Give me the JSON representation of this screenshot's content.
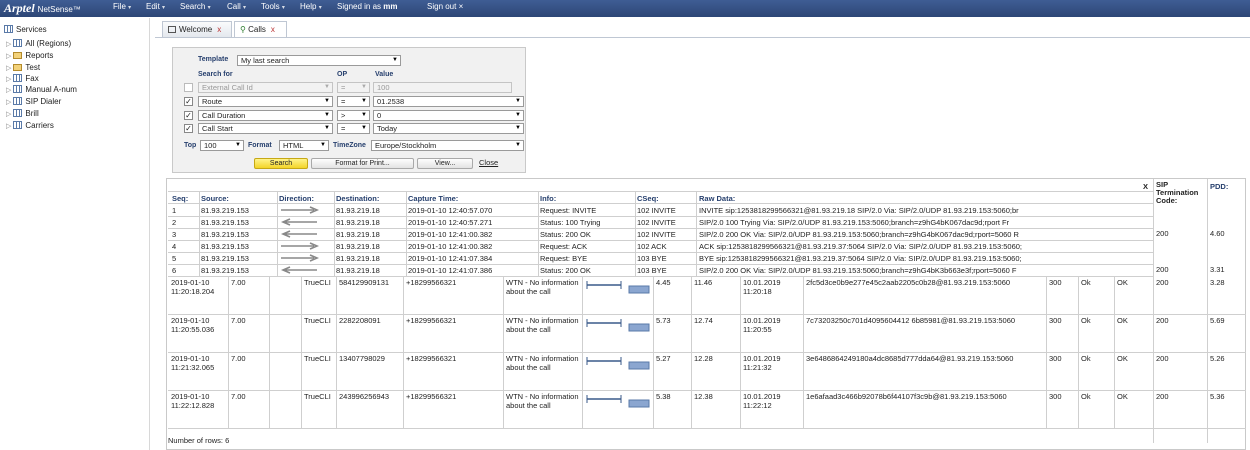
{
  "app": {
    "brand": "Arptel",
    "product": "NetSense™"
  },
  "menu": [
    {
      "label": "File",
      "arrow": "▾"
    },
    {
      "label": "Edit",
      "arrow": "▾"
    },
    {
      "label": "Search",
      "arrow": "▾"
    },
    {
      "label": "Call",
      "arrow": "▾"
    },
    {
      "label": "Tools",
      "arrow": "▾"
    },
    {
      "label": "Help",
      "arrow": "▾"
    },
    {
      "label": "Signed in as"
    },
    {
      "label": "Sign out"
    }
  ],
  "user": "mm",
  "tree": {
    "root": "Services",
    "items": [
      {
        "label": "All (Regions)",
        "icon": "grid-icon"
      },
      {
        "label": "Reports",
        "icon": "folder-icon"
      },
      {
        "label": "Test",
        "icon": "folder-icon"
      },
      {
        "label": "Fax",
        "icon": "grid-icon"
      },
      {
        "label": "Manual A-num",
        "icon": "grid-icon"
      },
      {
        "label": "SIP Dialer",
        "icon": "grid-icon"
      },
      {
        "label": "Brill",
        "icon": "grid-icon"
      },
      {
        "label": "Carriers",
        "icon": "grid-icon"
      }
    ]
  },
  "tabs": [
    {
      "label": "Welcome",
      "close": "x"
    },
    {
      "label": "Calls",
      "close": "x"
    }
  ],
  "search": {
    "template_label": "Template",
    "template_value": "My last search",
    "search_for_label": "Search for",
    "op_label": "OP",
    "value_label": "Value",
    "rows": [
      {
        "checked": false,
        "field": "External Call Id",
        "op": "=",
        "value": "100"
      },
      {
        "checked": true,
        "field": "Route",
        "op": "=",
        "value": "01.2538"
      },
      {
        "checked": true,
        "field": "Call Duration",
        "op": ">",
        "value": "0"
      },
      {
        "checked": true,
        "field": "Call Start",
        "op": "=",
        "value": "Today"
      }
    ],
    "top_label": "Top",
    "top_value": "100",
    "format_label": "Format",
    "format_value": "HTML",
    "timezone_label": "TimeZone",
    "timezone_value": "Europe/Stockholm",
    "buttons": {
      "search": "Search",
      "print": "Format for Print...",
      "view": "View...",
      "close": "Close"
    }
  },
  "trace": {
    "close": "X",
    "headers": [
      "Seq:",
      "Source:",
      "Direction:",
      "Destination:",
      "Capture Time:",
      "Info:",
      "CSeq:",
      "Raw Data:"
    ],
    "rows": [
      {
        "seq": "1",
        "src": "81.93.219.153",
        "dir": "right",
        "dst": "81.93.219.18",
        "time": "2019-01-10 12:40:57.070",
        "info": "Request: INVITE",
        "cseq": "102 INVITE",
        "raw": "INVITE sip:1253818299566321@81.93.219.18 SIP/2.0 Via: SIP/2.0/UDP 81.93.219.153:5060;br"
      },
      {
        "seq": "2",
        "src": "81.93.219.153",
        "dir": "left",
        "dst": "81.93.219.18",
        "time": "2019-01-10 12:40:57.271",
        "info": "Status: 100 Trying",
        "cseq": "102 INVITE",
        "raw": "SIP/2.0 100 Trying Via: SIP/2.0/UDP 81.93.219.153:5060;branch=z9hG4bK067dac9d;rport Fr"
      },
      {
        "seq": "3",
        "src": "81.93.219.153",
        "dir": "left",
        "dst": "81.93.219.18",
        "time": "2019-01-10 12:41:00.382",
        "info": "Status: 200 OK",
        "cseq": "102 INVITE",
        "raw": "SIP/2.0 200 OK Via: SIP/2.0/UDP 81.93.219.153:5060;branch=z9hG4bK067dac9d;rport=5060 R"
      },
      {
        "seq": "4",
        "src": "81.93.219.153",
        "dir": "right",
        "dst": "81.93.219.18",
        "time": "2019-01-10 12:41:00.382",
        "info": "Request: ACK",
        "cseq": "102 ACK",
        "raw": "ACK sip:1253818299566321@81.93.219.37:5064 SIP/2.0 Via: SIP/2.0/UDP 81.93.219.153:5060;"
      },
      {
        "seq": "5",
        "src": "81.93.219.153",
        "dir": "right",
        "dst": "81.93.219.18",
        "time": "2019-01-10 12:41:07.384",
        "info": "Request: BYE",
        "cseq": "103 BYE",
        "raw": "BYE sip:1253818299566321@81.93.219.37:5064 SIP/2.0 Via: SIP/2.0/UDP 81.93.219.153:5060;"
      },
      {
        "seq": "6",
        "src": "81.93.219.153",
        "dir": "left",
        "dst": "81.93.219.18",
        "time": "2019-01-10 12:41:07.386",
        "info": "Status: 200 OK",
        "cseq": "103 BYE",
        "raw": "SIP/2.0 200 OK Via: SIP/2.0/UDP 81.93.219.153:5060;branch=z9hG4bK3b663e3f;rport=5060 F"
      }
    ]
  },
  "columns": {
    "sip_term": "SIP Termination Code:",
    "pdd": "PDD:"
  },
  "right_rows": [
    {
      "sip": "",
      "pdd": ""
    },
    {
      "sip": "200",
      "pdd": "4.60"
    },
    {
      "sip": "",
      "pdd": ""
    },
    {
      "sip": "",
      "pdd": ""
    },
    {
      "sip": "200",
      "pdd": "3.31"
    },
    {
      "sip": "",
      "pdd": ""
    }
  ],
  "calls": [
    {
      "start": "2019-01-10 11:20:18.204",
      "route": "7.00",
      "carrier": "TrueCLI",
      "anum": "584129909131",
      "bnum": "+18299566321",
      "note": "WTN - No information about the call",
      "duration": "4.45",
      "dur2": "11.46",
      "time": "10.01.2019 11:20:18",
      "callid": "2fc5d3ce0b9e277e45c2aab2205c0b28@81.93.219.153:5060",
      "code": "300",
      "s1": "Ok",
      "s2": "OK",
      "sip": "200",
      "pdd": "3.28"
    },
    {
      "start": "2019-01-10 11:20:55.036",
      "route": "7.00",
      "carrier": "TrueCLI",
      "anum": "2282208091",
      "bnum": "+18299566321",
      "note": "WTN - No information about the call",
      "duration": "5.73",
      "dur2": "12.74",
      "time": "10.01.2019 11:20:55",
      "callid": "7c73203250c701d4095604412 6b85981@81.93.219.153:5060",
      "code": "300",
      "s1": "Ok",
      "s2": "OK",
      "sip": "200",
      "pdd": "5.69"
    },
    {
      "start": "2019-01-10 11:21:32.065",
      "route": "7.00",
      "carrier": "TrueCLI",
      "anum": "13407798029",
      "bnum": "+18299566321",
      "note": "WTN - No information about the call",
      "duration": "5.27",
      "dur2": "12.28",
      "time": "10.01.2019 11:21:32",
      "callid": "3e6486864249180a4dc8685d777dda64@81.93.219.153:5060",
      "code": "300",
      "s1": "Ok",
      "s2": "OK",
      "sip": "200",
      "pdd": "5.26"
    },
    {
      "start": "2019-01-10 11:22:12.828",
      "route": "7.00",
      "carrier": "TrueCLI",
      "anum": "243996256943",
      "bnum": "+18299566321",
      "note": "WTN - No information about the call",
      "duration": "5.38",
      "dur2": "12.38",
      "time": "10.01.2019 11:22:12",
      "callid": "1e6afaad3c466b92078b6f44107f3c9b@81.93.219.153:5060",
      "code": "300",
      "s1": "Ok",
      "s2": "OK",
      "sip": "200",
      "pdd": "5.36"
    }
  ],
  "footer": "Number of rows: 6",
  "colors": {
    "topbar": "#34508a",
    "header_text": "#27406e",
    "search_button": "#f3d428"
  }
}
